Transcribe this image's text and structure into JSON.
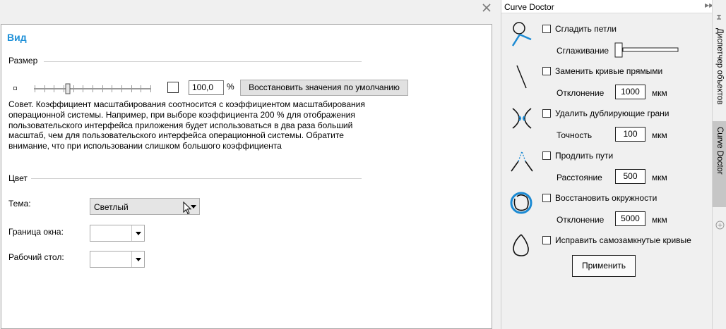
{
  "options_dialog": {
    "title": "Вид",
    "size_group": {
      "label": "Размер",
      "scale_value": "100,0",
      "scale_fraction": 0.28,
      "percent_sign": "%",
      "reset_button": "Восстановить значения по умолчанию",
      "tip": "Совет. Коэффициент масштабирования соотносится с коэффициентом масштабирования операционной системы. Например, при выборе коэффициента 200 % для отображения пользовательского интерфейса приложения будет использоваться в два раза больший масштаб, чем для пользовательского интерфейса операционной системы. Обратите внимание, что при использовании слишком большого коэффициента"
    },
    "color_group": {
      "label": "Цвет",
      "theme_label": "Тема:",
      "theme_value": "Светлый",
      "border_label": "Граница окна:",
      "desktop_label": "Рабочий стол:"
    }
  },
  "curve_doctor": {
    "title": "Curve Doctor",
    "smooth_loops": {
      "label": "Сгладить  петли",
      "param_label": "Сглаживание"
    },
    "replace_lines": {
      "label": "Заменить кривые прямыми",
      "param_label": "Отклонение",
      "value": "1000",
      "unit": "мкм"
    },
    "remove_duplicates": {
      "label": "Удалить дублирующие грани",
      "param_label": "Точность",
      "value": "100",
      "unit": "мкм"
    },
    "extend_paths": {
      "label": "Продлить пути",
      "param_label": "Расстояние",
      "value": "500",
      "unit": "мкм"
    },
    "restore_circles": {
      "label": "Восстановить окружности",
      "param_label": "Отклонение",
      "value": "5000",
      "unit": "мкм"
    },
    "fix_self_closed": {
      "label": "Исправить самозамкнутые кривые"
    },
    "apply_button": "Применить"
  },
  "side_tabs": {
    "object_manager": "Диспетчер объектов",
    "curve_doctor": "Curve Doctor"
  },
  "colors": {
    "title_blue": "#1e90d8",
    "icon_blue": "#1b8ad3",
    "active_tab": "#c6c6c6"
  }
}
